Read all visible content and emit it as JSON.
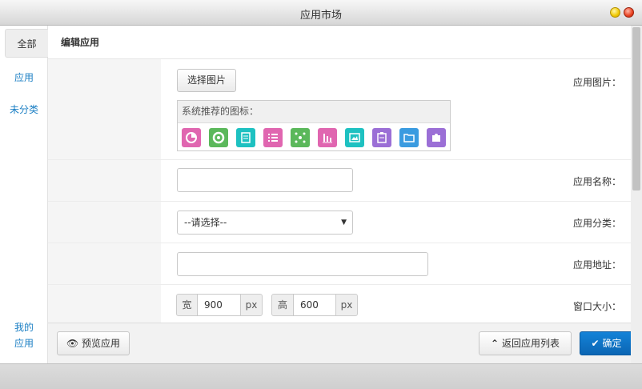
{
  "window": {
    "title": "应用市场"
  },
  "sidebar": {
    "tabs": [
      "全部"
    ],
    "links": [
      "应用",
      "未分类"
    ],
    "bottom_link": [
      "我的",
      "应用"
    ]
  },
  "panel": {
    "title": "编辑应用"
  },
  "form": {
    "image_label": "应用图片：",
    "choose_image_button": "选择图片",
    "recommended_icons_title": "系统推荐的图标：",
    "recommended_icons": [
      {
        "name": "pie-chart-icon",
        "color": "#e066b0"
      },
      {
        "name": "donut-chart-icon",
        "color": "#5bb85b"
      },
      {
        "name": "document-icon",
        "color": "#1ec1c1"
      },
      {
        "name": "list-icon",
        "color": "#e066b0"
      },
      {
        "name": "network-icon",
        "color": "#5bb85b"
      },
      {
        "name": "bar-chart-icon",
        "color": "#e066b0"
      },
      {
        "name": "picture-icon",
        "color": "#1ec1c1"
      },
      {
        "name": "clipboard-icon",
        "color": "#9b6fd6"
      },
      {
        "name": "folder-icon",
        "color": "#3a9be0"
      },
      {
        "name": "puzzle-icon",
        "color": "#9b6fd6"
      }
    ],
    "name_label": "应用名称：",
    "name_value": "",
    "category_label": "应用分类：",
    "category_selected": "--请选择--",
    "url_label": "应用地址：",
    "url_value": "",
    "size_label": "窗口大小：",
    "width_prefix": "宽",
    "width_value": "900",
    "width_unit": "px",
    "height_prefix": "高",
    "height_value": "600",
    "height_unit": "px"
  },
  "footer": {
    "preview_button": "预览应用",
    "back_button": "返回应用列表",
    "confirm_button": "确定"
  }
}
